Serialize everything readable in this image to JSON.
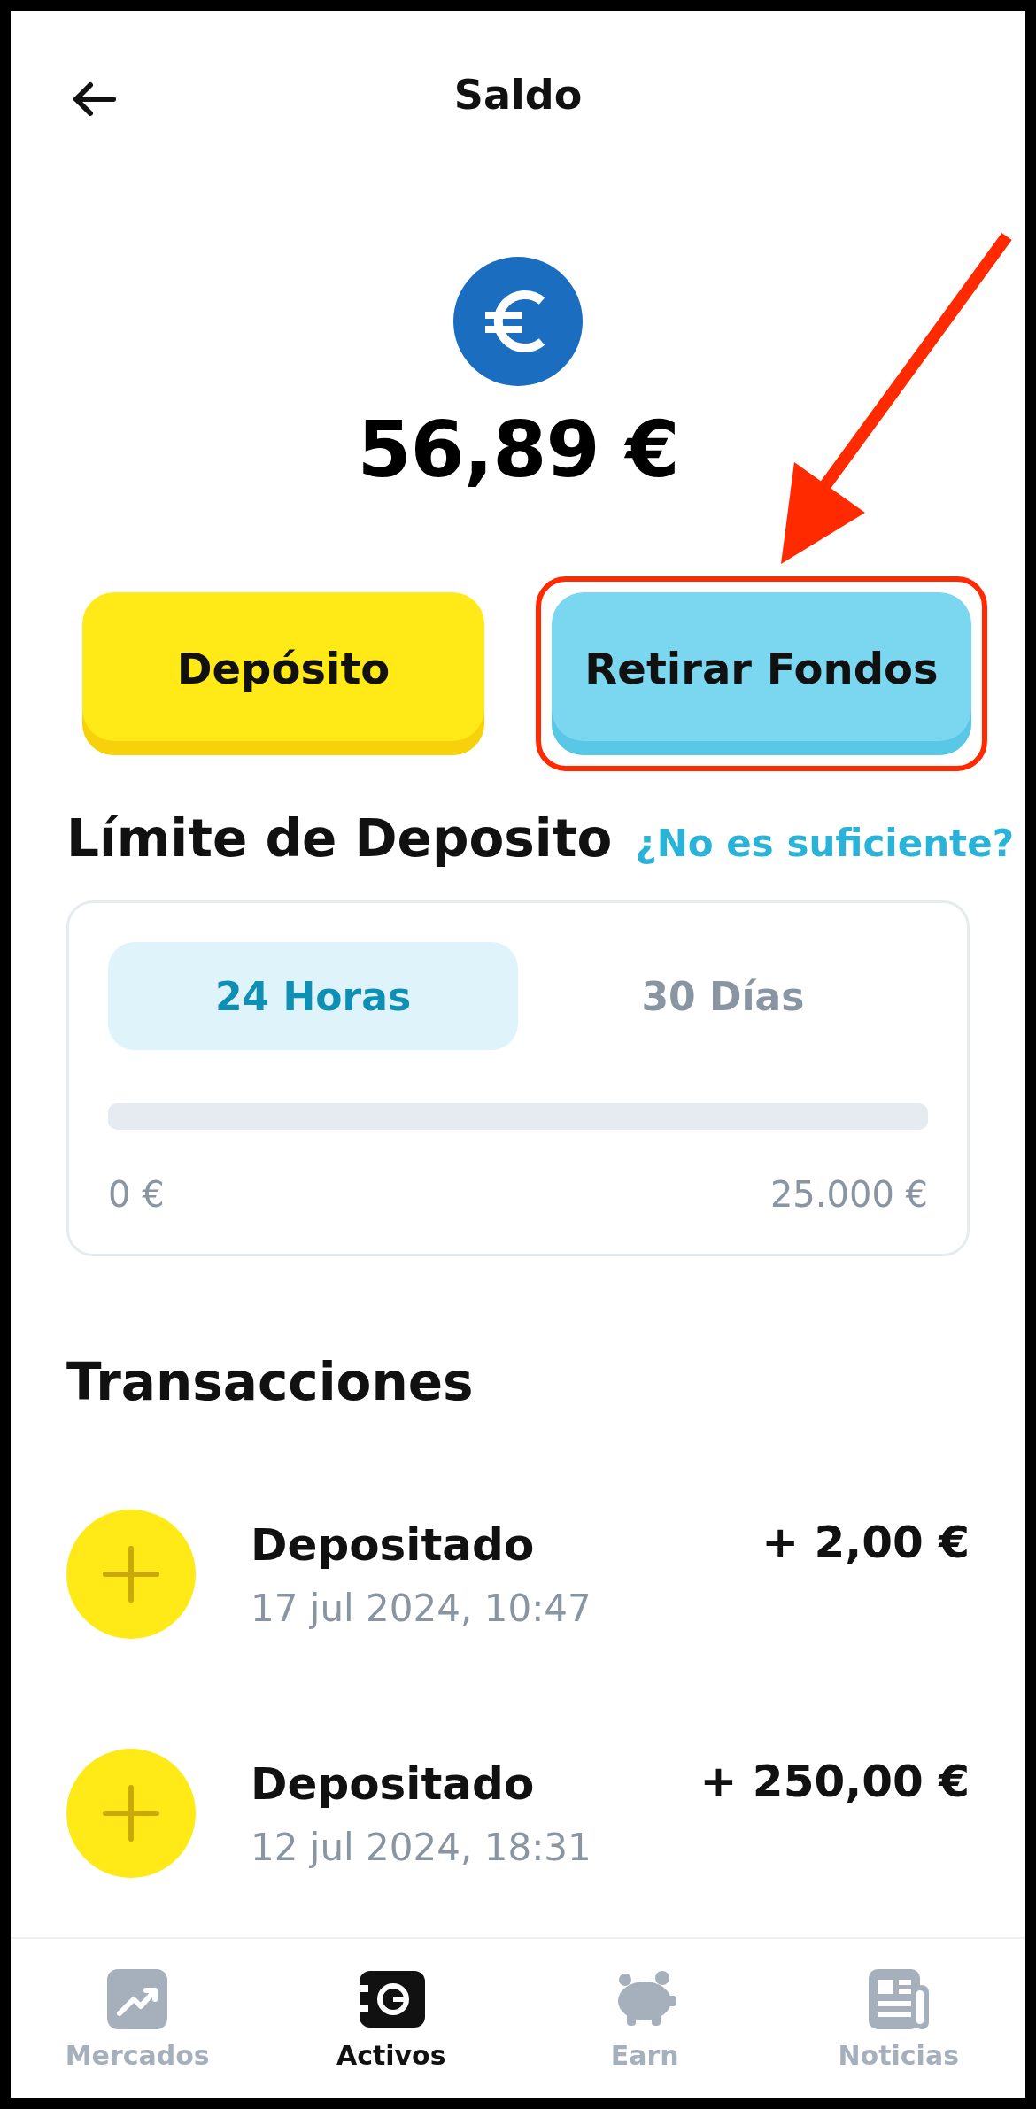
{
  "header": {
    "title": "Saldo"
  },
  "balance": {
    "amount": "56,89 €"
  },
  "actions": [
    {
      "label": "Depósito",
      "kind": "primary",
      "highlighted": false
    },
    {
      "label": "Retirar Fondos",
      "kind": "secondary",
      "highlighted": true
    }
  ],
  "deposit_limit": {
    "title": "Límite de Deposito",
    "link": "¿No es suficiente?",
    "tabs": [
      {
        "label": "24 Horas",
        "selected": true
      },
      {
        "label": "30 Días",
        "selected": false
      }
    ],
    "level": 0,
    "min_label": "0 €",
    "max_label": "25.000 €"
  },
  "transactions": {
    "title": "Transacciones",
    "items": [
      {
        "title": "Depositado",
        "date": "17 jul 2024, 10:47",
        "amount": "+ 2,00 €"
      },
      {
        "title": "Depositado",
        "date": "12 jul 2024, 18:31",
        "amount": "+ 250,00 €"
      }
    ]
  },
  "bottom_nav": [
    {
      "label": "Mercados",
      "kind": "markets",
      "selected": false
    },
    {
      "label": "Activos",
      "kind": "assets",
      "selected": true
    },
    {
      "label": "Earn",
      "kind": "earn",
      "selected": false
    },
    {
      "label": "Noticias",
      "kind": "news",
      "selected": false
    }
  ]
}
